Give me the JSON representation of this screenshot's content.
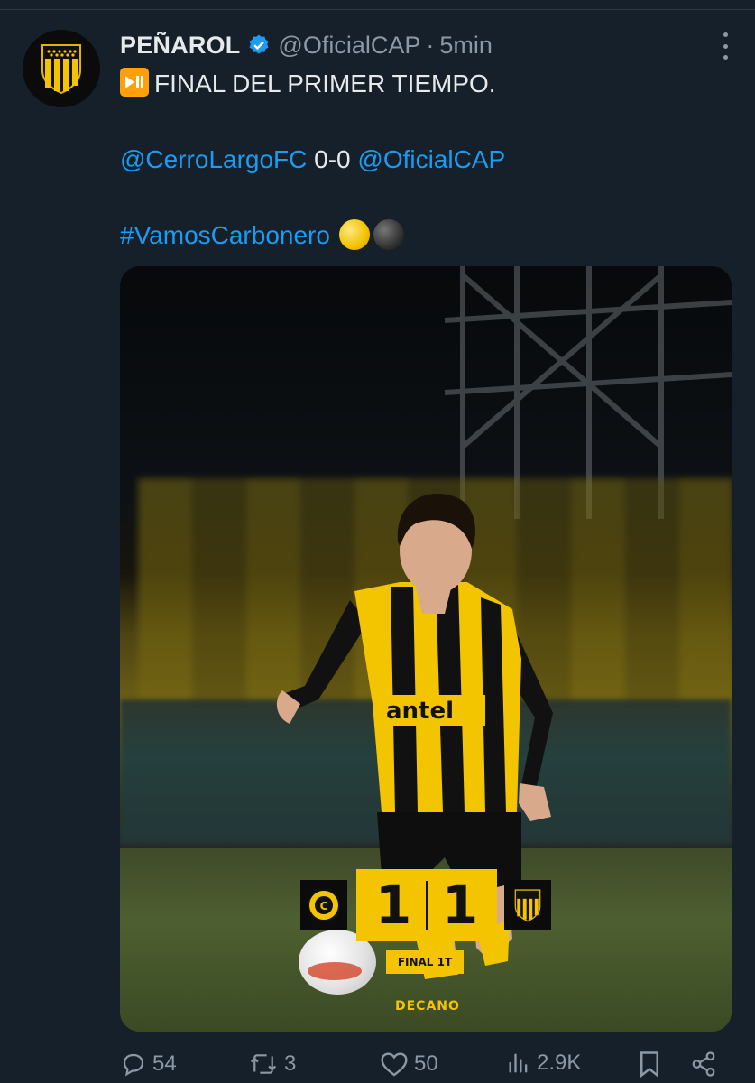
{
  "tweet": {
    "display_name": "PEÑAROL",
    "handle": "@OficialCAP",
    "separator": "·",
    "time": "5min",
    "text": {
      "line1": "FINAL DEL PRIMER TIEMPO.",
      "mention_home": "@CerroLargoFC",
      "score": "0-0",
      "mention_away": "@OficialCAP",
      "hashtag": "#VamosCarbonero"
    }
  },
  "media": {
    "score_home": "1",
    "score_away": "1",
    "period": "FINAL 1T",
    "brand": "DECANO",
    "sponsor": "antel"
  },
  "actions": {
    "replies": "54",
    "reposts": "3",
    "likes": "50",
    "views": "2.9K"
  },
  "colors": {
    "background": "#15202b",
    "link": "#1d9bf0",
    "muted": "#8b98a5",
    "club_yellow": "#f4c400"
  },
  "icons": [
    "verified-badge-icon",
    "more-options-icon",
    "play-pause-icon",
    "reply-icon",
    "repost-icon",
    "like-icon",
    "views-icon",
    "bookmark-icon",
    "share-icon"
  ]
}
